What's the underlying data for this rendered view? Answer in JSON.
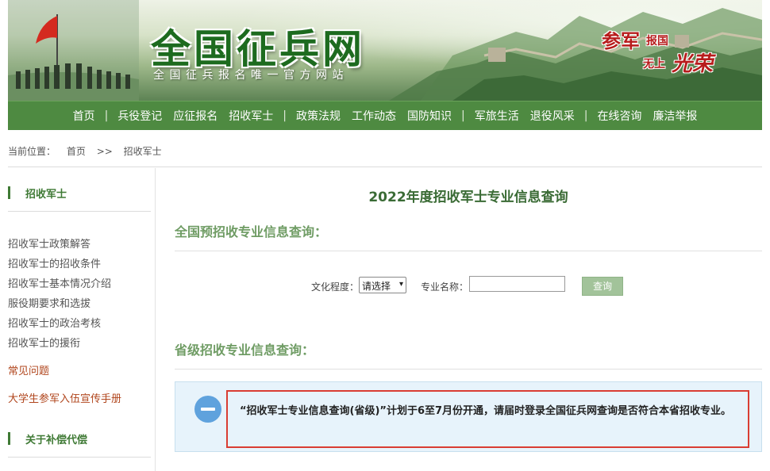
{
  "banner": {
    "title": "全国征兵网",
    "subtitle": "全国征兵报名唯一官方网站",
    "slogan": {
      "part1": "参军",
      "part2": "报国",
      "part3": "无上",
      "part4": "光荣"
    }
  },
  "nav": {
    "items": [
      "首页",
      "兵役登记",
      "应征报名",
      "招收军士",
      "政策法规",
      "工作动态",
      "国防知识",
      "军旅生活",
      "退役风采",
      "在线咨询",
      "廉洁举报"
    ],
    "separator": "|"
  },
  "breadcrumb": {
    "label": "当前位置：",
    "home": "首页",
    "arrow": ">>",
    "current": "招收军士"
  },
  "sidebar": {
    "section1_title": "招收军士",
    "links": [
      "招收军士政策解答",
      "招收军士的招收条件",
      "招收军士基本情况介绍",
      "服役期要求和选拔",
      "招收军士的政治考核",
      "招收军士的援衔"
    ],
    "faq": "常见问题",
    "handbook": "大学生参军入伍宣传手册",
    "section2_title": "关于补偿代偿"
  },
  "main": {
    "title": "2022年度招收军士专业信息查询",
    "national_title": "全国预招收专业信息查询：",
    "education_label": "文化程度：",
    "education_value": "请选择",
    "major_label": "专业名称：",
    "major_value": "",
    "query_button": "查询",
    "provincial_title": "省级招收专业信息查询：",
    "notice": "“招收军士专业信息查询(省级)”计划于6至7月份开通，请届时登录全国征兵网查询是否符合本省招收专业。"
  },
  "colors": {
    "nav_green": "#4e8a41",
    "title_green": "#3a6b35",
    "highlight_red": "#d93d33",
    "notice_bg": "#e7f3fb"
  }
}
